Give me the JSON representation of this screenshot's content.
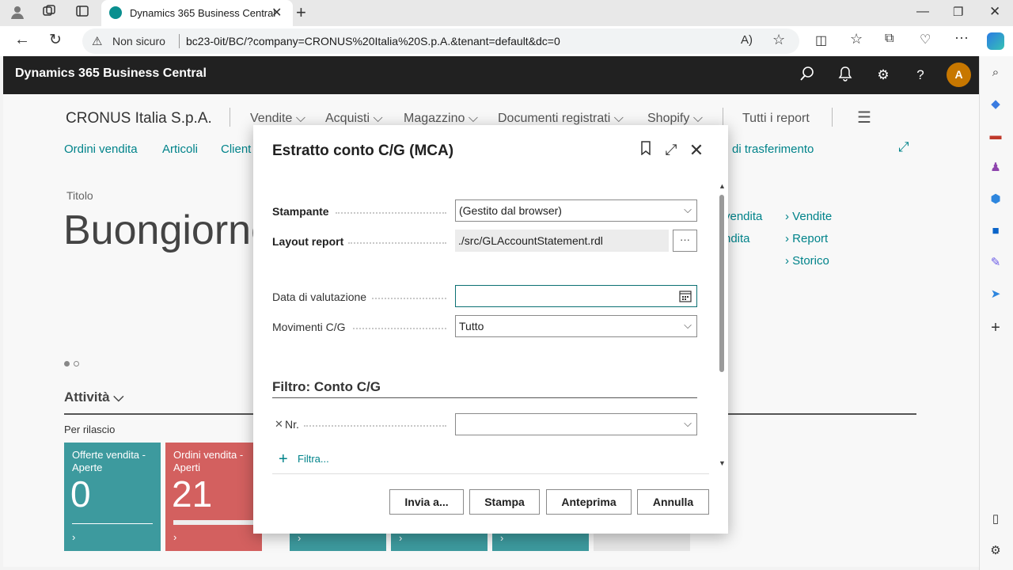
{
  "browser": {
    "tab_title": "Dynamics 365 Business Central",
    "new_tab_symbol": "+",
    "not_secure": "Non sicuro",
    "url": "bc23-0it/BC/?company=CRONUS%20Italia%20S.p.A.&tenant=default&dc=0"
  },
  "app": {
    "brand": "Dynamics 365 Business Central",
    "avatar_initial": "A"
  },
  "nav": {
    "company": "CRONUS Italia S.p.A.",
    "menus": [
      "Vendite",
      "Acquisti",
      "Magazzino",
      "Documenti registrati",
      "Shopify"
    ],
    "all_reports": "Tutti i report",
    "links": [
      "Ordini vendita",
      "Articoli",
      "Client"
    ],
    "link_right": "di trasferimento"
  },
  "home": {
    "title_label": "Titolo",
    "greeting": "Buongiorno",
    "right_links_partial": [
      "vendita",
      "ndita"
    ],
    "right_links": [
      "Vendite",
      "Report",
      "Storico"
    ],
    "activities": "Attività",
    "per_rilascio": "Per rilascio",
    "tiles": [
      {
        "label": "Offerte vendita - Aperte",
        "value": "0",
        "color": "#3d9a9e"
      },
      {
        "label": "Ordini vendita - Aperti",
        "value": "21",
        "color": "#d3605f"
      }
    ]
  },
  "dialog": {
    "title": "Estratto conto C/G  (MCA)",
    "printer_label": "Stampante",
    "printer_value": "(Gestito dal browser)",
    "layout_label": "Layout report",
    "layout_value": "./src/GLAccountStatement.rdl",
    "more_symbol": "···",
    "date_label": "Data di valutazione",
    "date_value": "",
    "entries_label": "Movimenti C/G",
    "entries_value": "Tutto",
    "filter_heading": "Filtro: Conto C/G",
    "filter_field_label": "Nr.",
    "filter_field_value": "",
    "add_filter": "Filtra...",
    "buttons": [
      "Invia a...",
      "Stampa",
      "Anteprima",
      "Annulla"
    ]
  }
}
